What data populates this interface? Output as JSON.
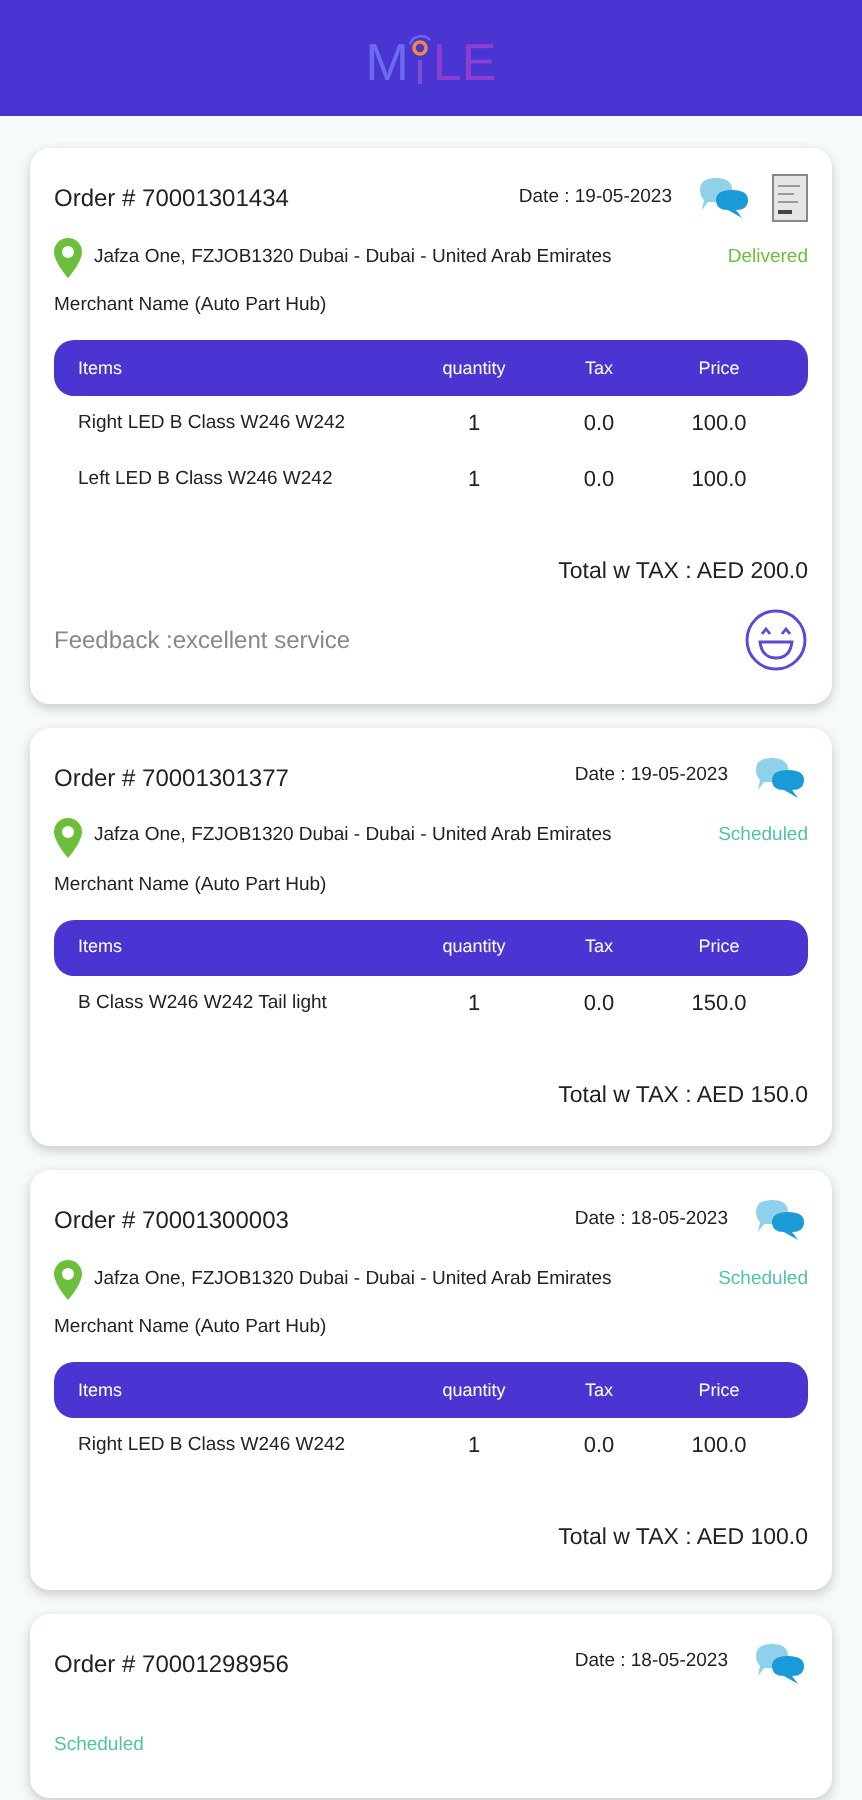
{
  "header": {
    "logo_left": "M",
    "logo_right": "LE"
  },
  "orders": [
    {
      "order": "Order # 70001301434",
      "date": "Date : 19-05-2023",
      "receipt": true,
      "address": "Jafza One, FZJOB1320 Dubai - Dubai - United Arab Emirates",
      "status": {
        "text": "Delivered",
        "kind": "delivered"
      },
      "merchant": "Merchant Name (Auto Part Hub)",
      "columns": [
        "Items",
        "quantity",
        "Tax",
        "Price"
      ],
      "rows": [
        [
          "Right LED B Class W246 W242",
          "1",
          "0.0",
          "100.0"
        ],
        [
          "Left LED B Class W246 W242",
          "1",
          "0.0",
          "100.0"
        ]
      ],
      "total": "Total w TAX : AED 200.0",
      "feedback": "Feedback :excellent service"
    },
    {
      "order": "Order # 70001301377",
      "date": "Date : 19-05-2023",
      "receipt": false,
      "address": "Jafza One, FZJOB1320 Dubai - Dubai - United Arab Emirates",
      "status": {
        "text": "Scheduled",
        "kind": "scheduled"
      },
      "merchant": "Merchant Name (Auto Part Hub)",
      "columns": [
        "Items",
        "quantity",
        "Tax",
        "Price"
      ],
      "rows": [
        [
          "B Class W246 W242 Tail light",
          "1",
          "0.0",
          "150.0"
        ]
      ],
      "total": "Total w TAX : AED 150.0"
    },
    {
      "order": "Order # 70001300003",
      "date": "Date : 18-05-2023",
      "receipt": false,
      "address": "Jafza One, FZJOB1320 Dubai - Dubai - United Arab Emirates",
      "status": {
        "text": "Scheduled",
        "kind": "scheduled"
      },
      "merchant": "Merchant Name (Auto Part Hub)",
      "columns": [
        "Items",
        "quantity",
        "Tax",
        "Price"
      ],
      "rows": [
        [
          "Right LED B Class W246 W242",
          "1",
          "0.0",
          "100.0"
        ]
      ],
      "total": "Total w TAX : AED 100.0"
    },
    {
      "order": "Order # 70001298956",
      "date": "Date : 18-05-2023",
      "receipt": false,
      "status": {
        "text": "Scheduled",
        "kind": "scheduled"
      }
    }
  ]
}
